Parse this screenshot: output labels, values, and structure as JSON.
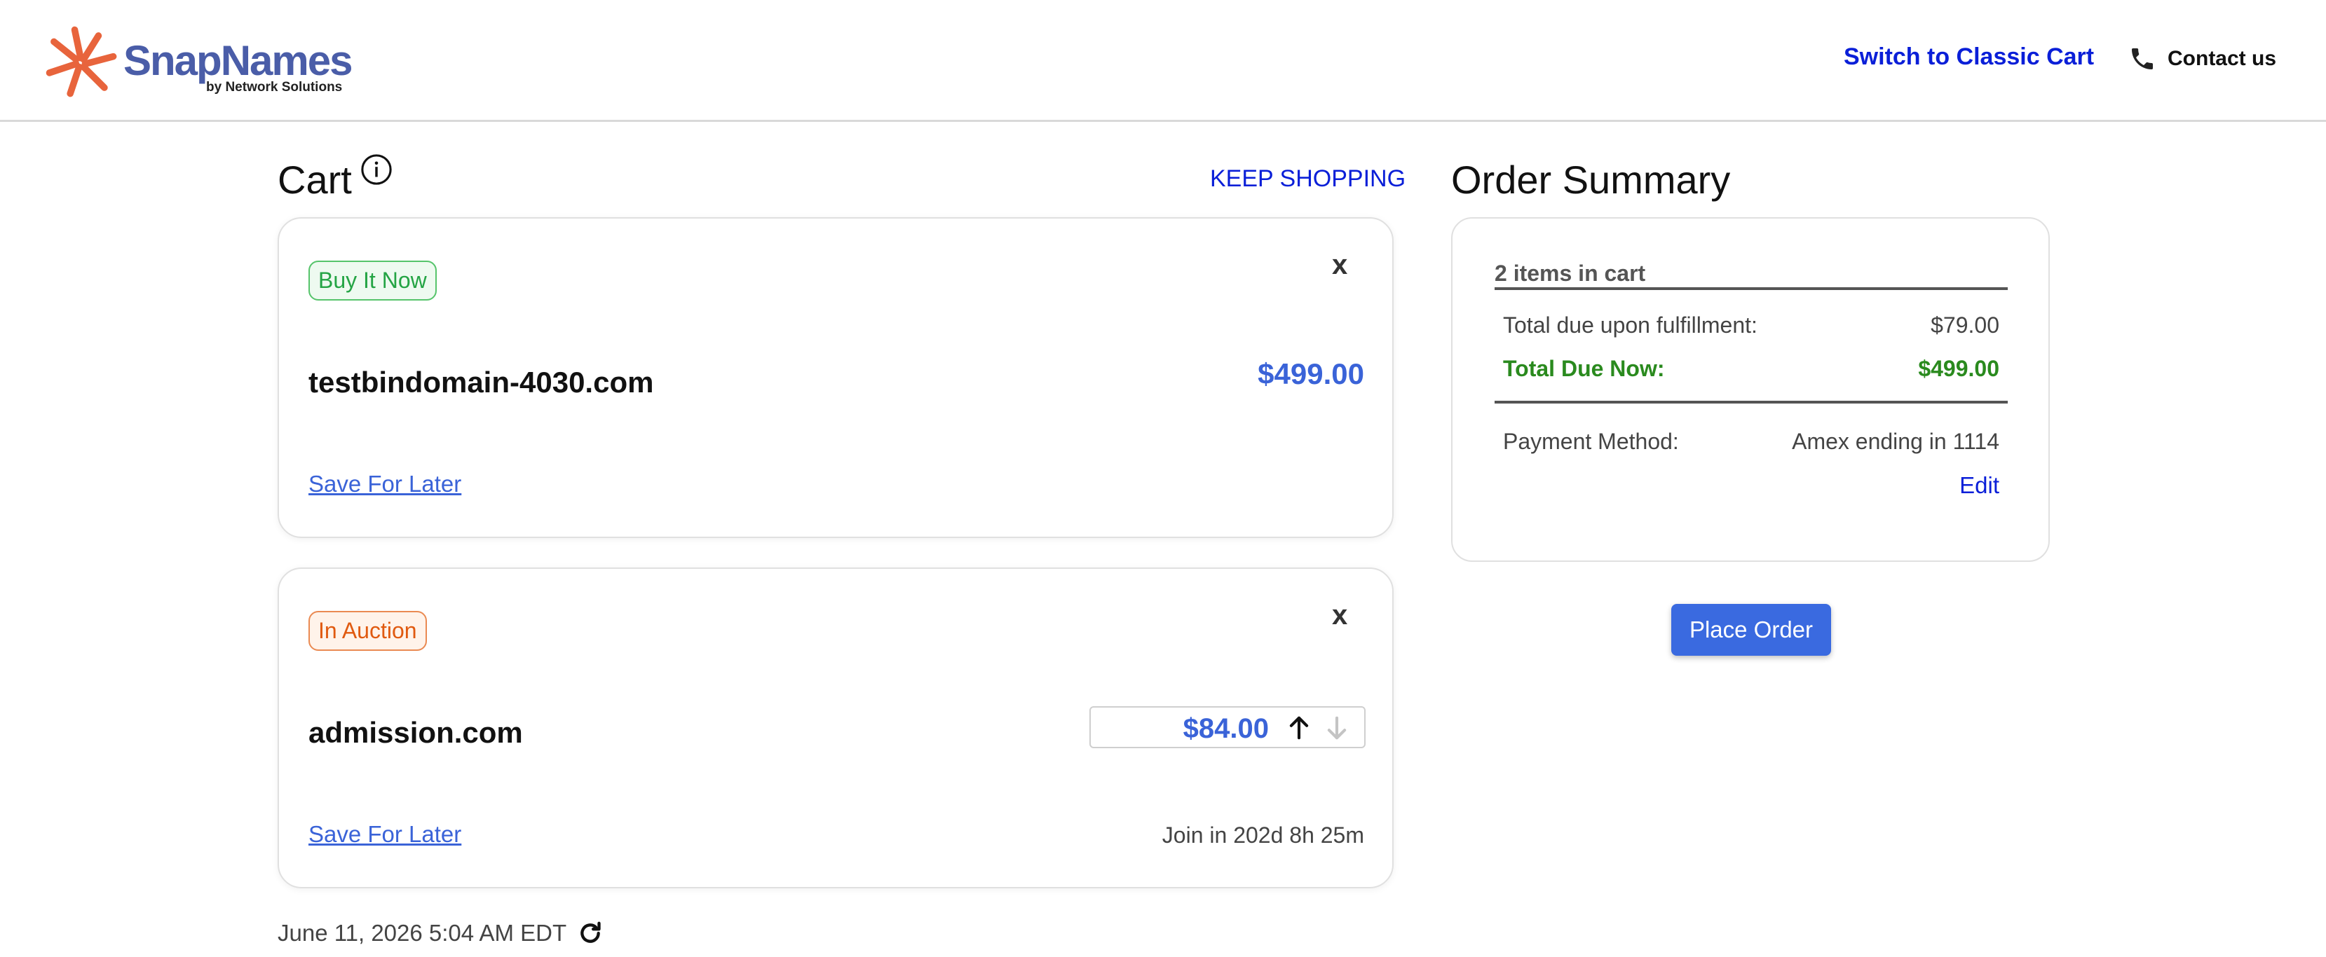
{
  "brand": {
    "name": "SnapNames",
    "tagline": "by Network Solutions",
    "logo_color": "#e8643c",
    "name_color": "#4a5da8"
  },
  "header": {
    "switch_link": "Switch to Classic Cart",
    "contact_label": "Contact us",
    "contact_icon": "phone-icon"
  },
  "cart": {
    "title": "Cart",
    "title_icon": "info-icon",
    "keep_shopping": "KEEP SHOPPING",
    "items": [
      {
        "badge": "Buy It Now",
        "domain": "testbindomain-4030.com",
        "price": "$499.00",
        "remove_label": "x",
        "save_for_later": "Save For Later"
      },
      {
        "badge": "In Auction",
        "domain": "admission.com",
        "bid_amount": "$84.00",
        "remove_label": "x",
        "save_for_later": "Save For Later",
        "countdown": "Join in 202d 8h 25m"
      }
    ],
    "timestamp": "June 11, 2026 5:04 AM EDT"
  },
  "summary": {
    "title": "Order Summary",
    "items_count": "2 items in cart",
    "fulfillment_label": "Total due upon fulfillment:",
    "fulfillment_value": "$79.00",
    "due_now_label": "Total Due Now:",
    "due_now_value": "$499.00",
    "payment_label": "Payment Method:",
    "payment_value": "Amex ending in 1114",
    "edit_label": "Edit",
    "place_order": "Place Order"
  },
  "colors": {
    "link": "#0a1fd8",
    "price_blue": "#3a63d8",
    "success_green": "#2a8a1e",
    "auction_orange": "#e05a10",
    "button_blue": "#3a6ae0"
  }
}
